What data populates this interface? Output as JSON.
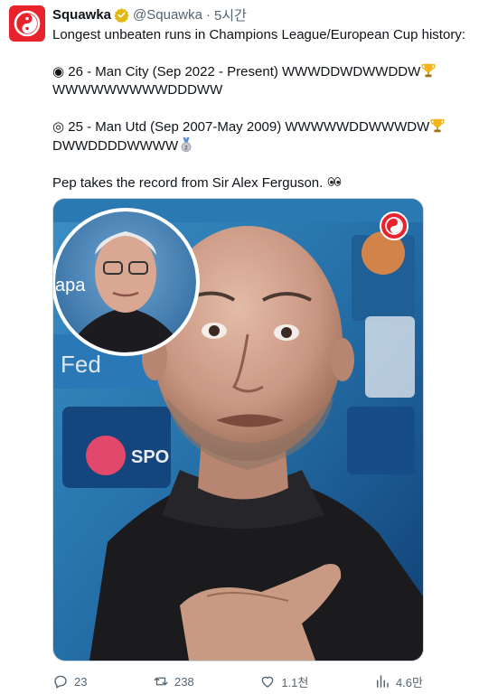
{
  "tweet": {
    "author_name": "Squawka",
    "handle": "@Squawka",
    "separator": "·",
    "time": "5시간",
    "line1": "Longest unbeaten runs in Champions League/European Cup history:",
    "line2": "◉ 26 - Man City (Sep 2022 - Present) WWWDDWDWWDDW",
    "line3": "WWWWWWWWWDDDWW",
    "line4": "◎ 25 - Man Utd (Sep 2007-May 2009) WWWWWDDWWWDW",
    "line5": "DWWDDDDWWWW",
    "line6": "Pep takes the record from Sir Alex Ferguson. ",
    "icons": {
      "trophy": "trophy-icon",
      "silver_medal": "second-place-medal-icon",
      "eyes": "eyes-icon",
      "verified": "verified-badge-icon"
    }
  },
  "actions": {
    "replies": "23",
    "retweets": "238",
    "likes": "1.1천",
    "views": "4.6만"
  },
  "colors": {
    "brand_red": "#e8232d",
    "verified_gold": "#e2b719",
    "text_primary": "#0f1419",
    "text_secondary": "#536471"
  }
}
